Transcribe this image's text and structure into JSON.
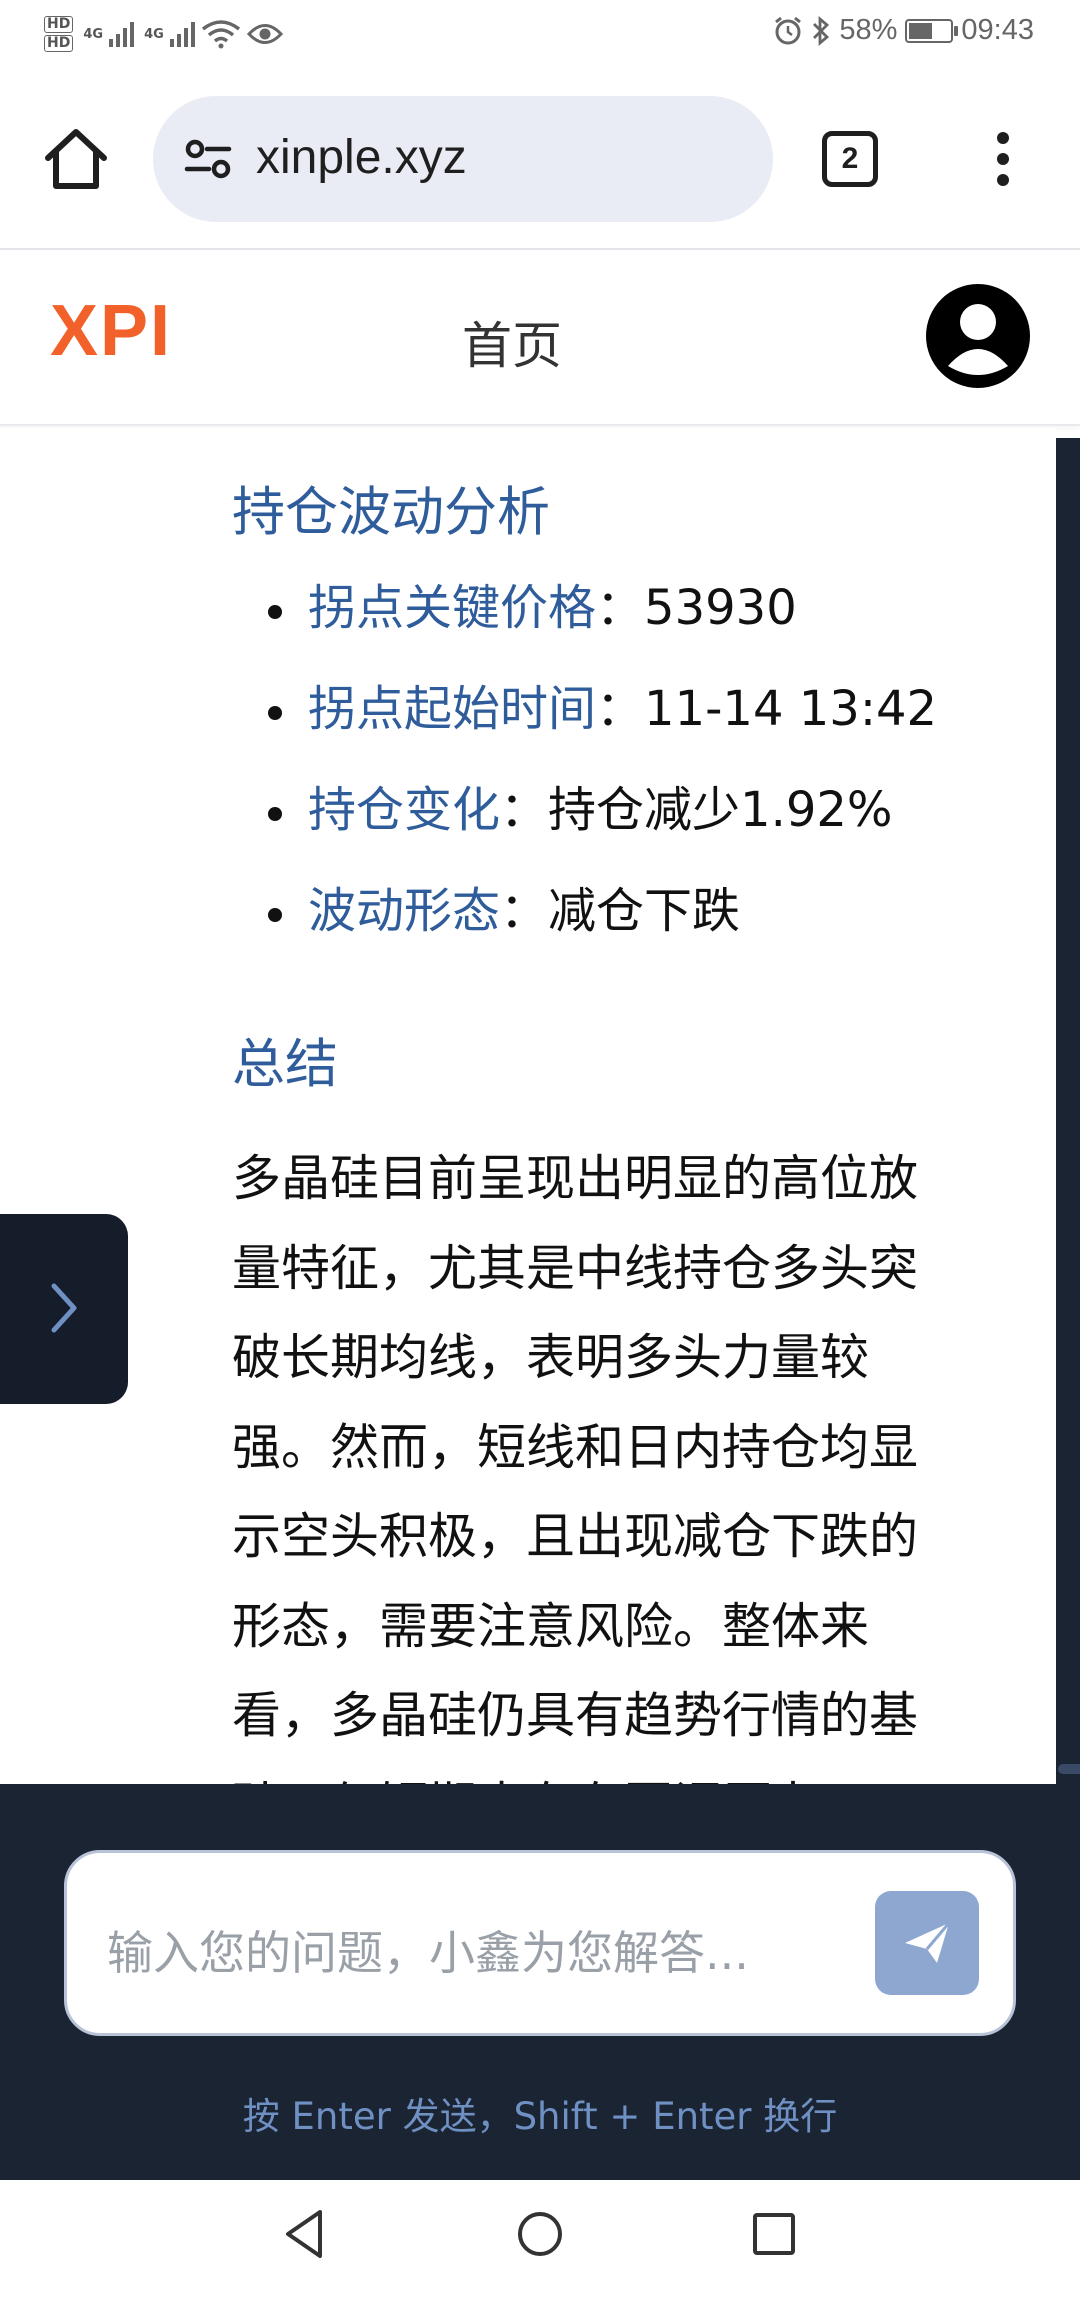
{
  "status_bar": {
    "left_icons": [
      "hd-icon",
      "4g-signal-icon",
      "4g-signal-icon",
      "wifi-icon",
      "eye-icon"
    ],
    "network_label_1": "4G",
    "network_label_2": "4G",
    "right_icons": [
      "alarm-icon",
      "bluetooth-icon",
      "battery-icon"
    ],
    "battery_percent": "58%",
    "battery_level": 0.58,
    "time": "09:43"
  },
  "browser": {
    "url": "xinple.xyz",
    "tab_count": "2"
  },
  "site_header": {
    "logo": "XPI",
    "nav_home": "首页"
  },
  "content": {
    "section_title": "持仓波动分析",
    "items": [
      {
        "key": "拐点关键价格",
        "sep": "：",
        "value": "53930"
      },
      {
        "key": "拐点起始时间",
        "sep": "：",
        "value": "11-14 13:42"
      },
      {
        "key": "持仓变化",
        "sep": "：",
        "value": "持仓减少1.92%"
      },
      {
        "key": "波动形态",
        "sep": "：",
        "value": "减仓下跌"
      }
    ],
    "summary_title": "总结",
    "summary_text": "多晶硅目前呈现出明显的高位放量特征，尤其是中线持仓多头突破长期均线，表明多头力量较强。然而，短线和日内持仓均显示空头积极，且出现减仓下跌的形态，需要注意风险。整体来看，多晶硅仍具有趋势行情的基础，但短期内存在回调压力。"
  },
  "chat": {
    "input_placeholder": "输入您的问题，小鑫为您解答...",
    "hint": "按 Enter 发送，Shift + Enter 换行"
  },
  "colors": {
    "accent_logo": "#f2612a",
    "heading_blue": "#2f5c9a",
    "panel_dark": "#1b2433",
    "send_button": "#8ea7d0"
  }
}
